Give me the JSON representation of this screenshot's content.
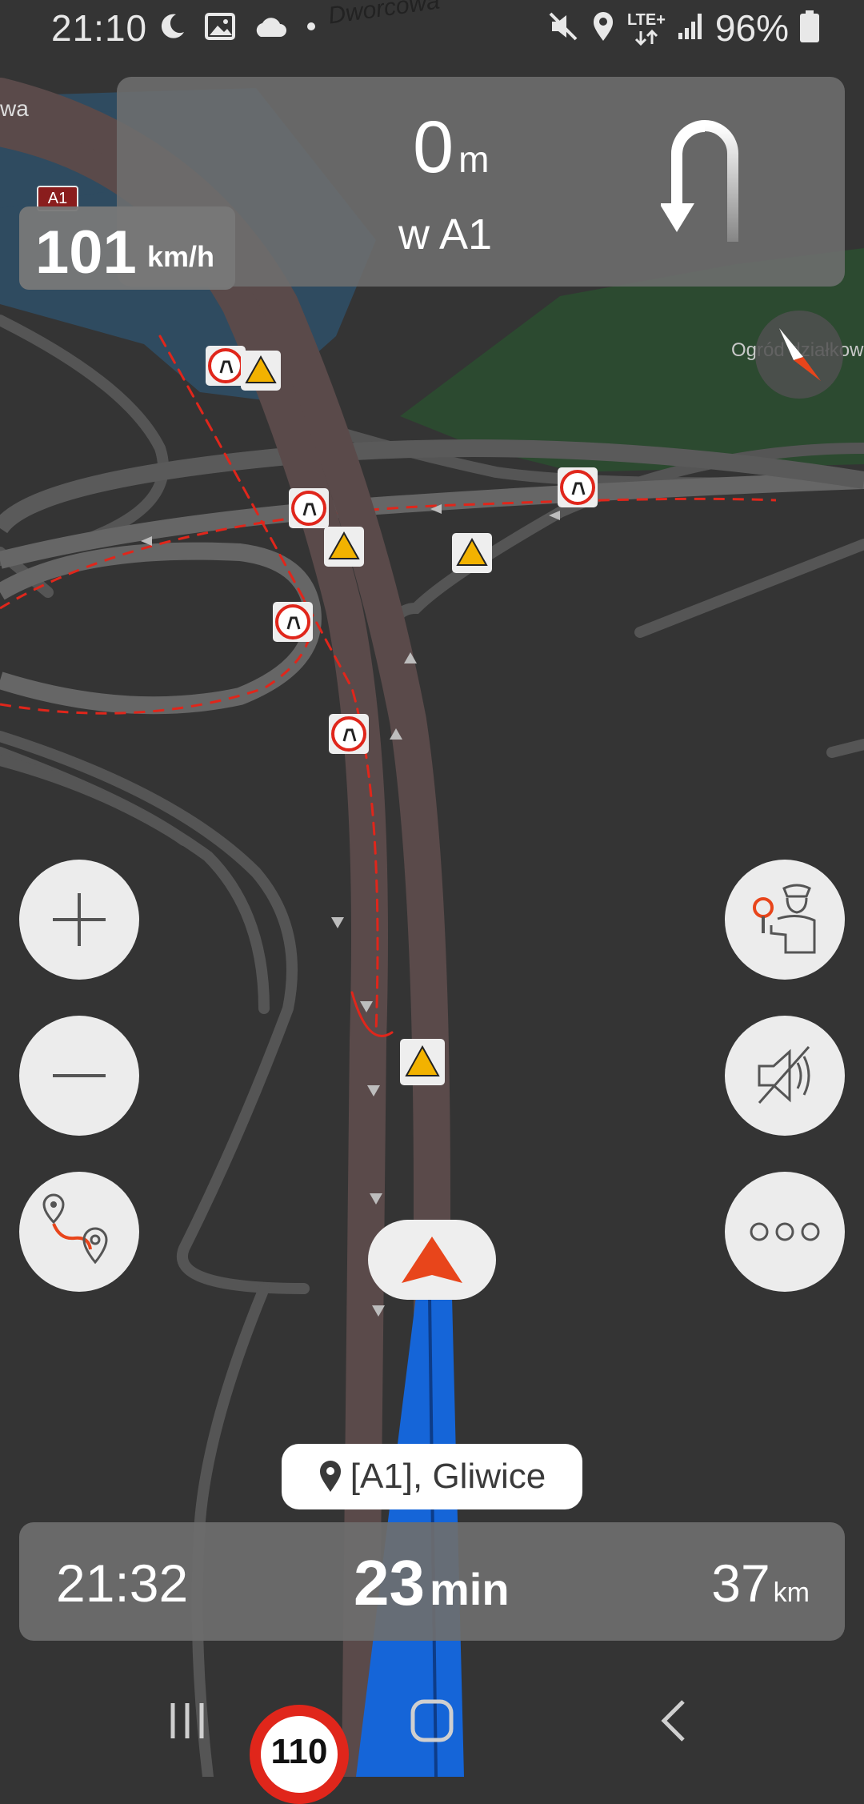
{
  "status_bar": {
    "time": "21:10",
    "network": "LTE+",
    "battery_percent": "96%"
  },
  "map": {
    "street_label_top": "Dworcowa",
    "street_label_left": "wa",
    "area_label_right": "Ogród działkow",
    "road_shield": "A1"
  },
  "turn_instruction": {
    "distance_value": "0",
    "distance_unit": "m",
    "road": "w A1",
    "maneuver_icon": "u-turn-arrow-icon"
  },
  "current_speed": {
    "value": "101",
    "unit": "km/h"
  },
  "buttons": {
    "zoom_in": "plus-icon",
    "zoom_out": "minus-icon",
    "route": "route-icon",
    "report_police": "police-officer-icon",
    "mute": "speaker-muted-icon",
    "more": "more-options-icon"
  },
  "destination": {
    "label": "[A1], Gliwice"
  },
  "eta": {
    "arrival_time": "21:32",
    "duration_value": "23",
    "duration_unit": "min",
    "distance_value": "37",
    "distance_unit": "km"
  },
  "speed_limit": {
    "value": "110"
  },
  "colors": {
    "route_blue": "#1565d8",
    "closed_road": "#5a4a4a",
    "closure_red": "#e0261b",
    "accent_orange": "#e8451b"
  }
}
